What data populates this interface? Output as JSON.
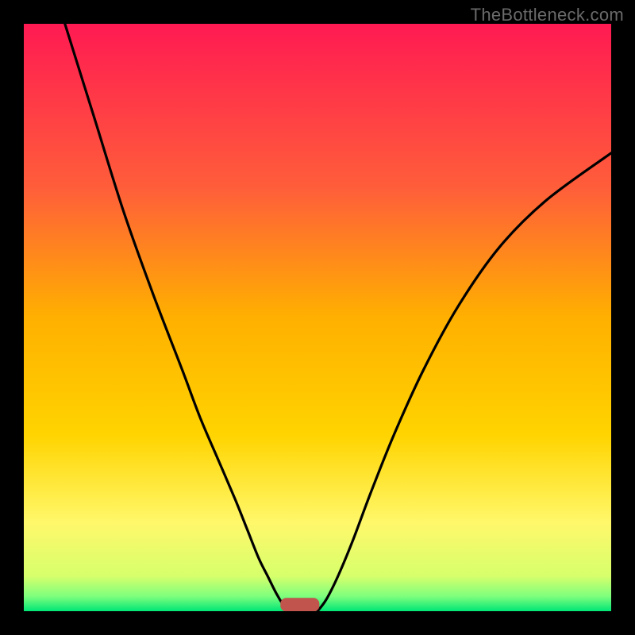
{
  "watermark": "TheBottleneck.com",
  "colors": {
    "frame": "#000000",
    "gradient_top": "#ff1a52",
    "gradient_mid_upper": "#ff8a2a",
    "gradient_mid": "#ffd400",
    "gradient_lower": "#fff86b",
    "gradient_near_bottom": "#c8ff70",
    "gradient_bottom": "#00e676",
    "curve": "#000000",
    "marker_fill": "#c1554d",
    "marker_stroke": "#c1554d"
  },
  "chart_data": {
    "type": "line",
    "title": "",
    "xlabel": "",
    "ylabel": "",
    "xlim": [
      0,
      100
    ],
    "ylim": [
      0,
      100
    ],
    "series": [
      {
        "name": "left-curve",
        "x": [
          7,
          12,
          17,
          22,
          27,
          30,
          33,
          36,
          38,
          40,
          41.5,
          43,
          44.2,
          45
        ],
        "y": [
          100,
          84,
          68,
          54,
          41,
          33,
          26,
          19,
          14,
          9,
          6,
          3,
          1,
          0
        ]
      },
      {
        "name": "right-curve",
        "x": [
          50,
          51.5,
          53.5,
          56,
          59,
          63,
          68,
          74,
          81,
          89,
          100
        ],
        "y": [
          0,
          2,
          6,
          12,
          20,
          30,
          41,
          52,
          62,
          70,
          78
        ]
      }
    ],
    "marker": {
      "x_center": 47,
      "y": 0,
      "width": 6.5,
      "height": 2.2
    },
    "notes": "Gradient background from red (top, high bottleneck) to green (bottom, optimal). Curves dip to zero near x≈45–50 where the small rounded marker sits on the x-axis."
  }
}
